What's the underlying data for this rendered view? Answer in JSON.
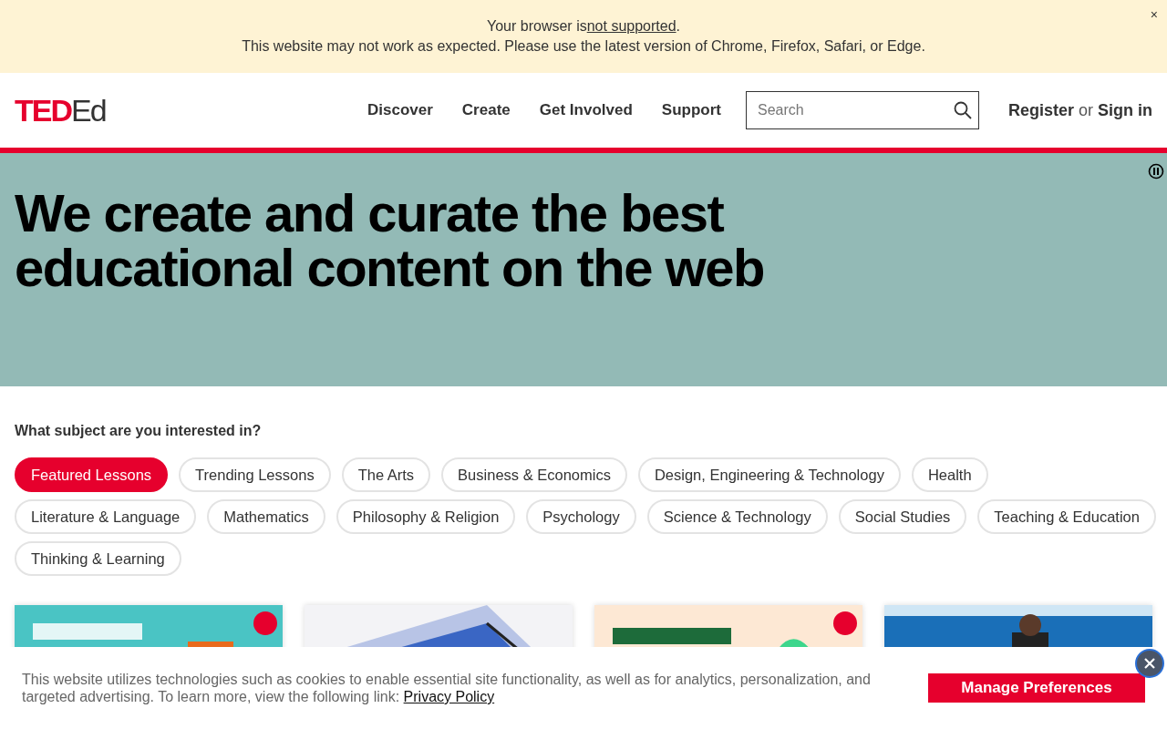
{
  "notice": {
    "line1_before": "Your browser is",
    "line1_link": "not supported",
    "line1_after": ".",
    "line2": "This website may not work as expected. Please use the latest version of Chrome, Firefox, Safari, or Edge.",
    "close": "×"
  },
  "header": {
    "logo": {
      "red": "TED",
      "dark": "Ed"
    },
    "nav": [
      "Discover",
      "Create",
      "Get Involved",
      "Support"
    ],
    "search": {
      "placeholder": "Search"
    },
    "register": "Register",
    "or": "or",
    "sign_in": "Sign in"
  },
  "hero": {
    "title": "We create and curate the best educational content on the web",
    "playing": true
  },
  "subjects": {
    "question": "What subject are you interested in?",
    "chips": [
      {
        "label": "Featured Lessons",
        "selected": true
      },
      {
        "label": "Trending Lessons",
        "selected": false
      },
      {
        "label": "The Arts",
        "selected": false
      },
      {
        "label": "Business & Economics",
        "selected": false
      },
      {
        "label": "Design, Engineering & Technology",
        "selected": false
      },
      {
        "label": "Health",
        "selected": false
      },
      {
        "label": "Literature & Language",
        "selected": false
      },
      {
        "label": "Mathematics",
        "selected": false
      },
      {
        "label": "Philosophy & Religion",
        "selected": false
      },
      {
        "label": "Psychology",
        "selected": false
      },
      {
        "label": "Science & Technology",
        "selected": false
      },
      {
        "label": "Social Studies",
        "selected": false
      },
      {
        "label": "Teaching & Education",
        "selected": false
      },
      {
        "label": "Thinking & Learning",
        "selected": false
      }
    ]
  },
  "cookie": {
    "text": "This website utilizes technologies such as cookies to enable essential site functionality, as well as for analytics, personalization, and targeted advertising. To learn more, view the following link:",
    "link": "Privacy Policy",
    "button": "Manage Preferences"
  }
}
